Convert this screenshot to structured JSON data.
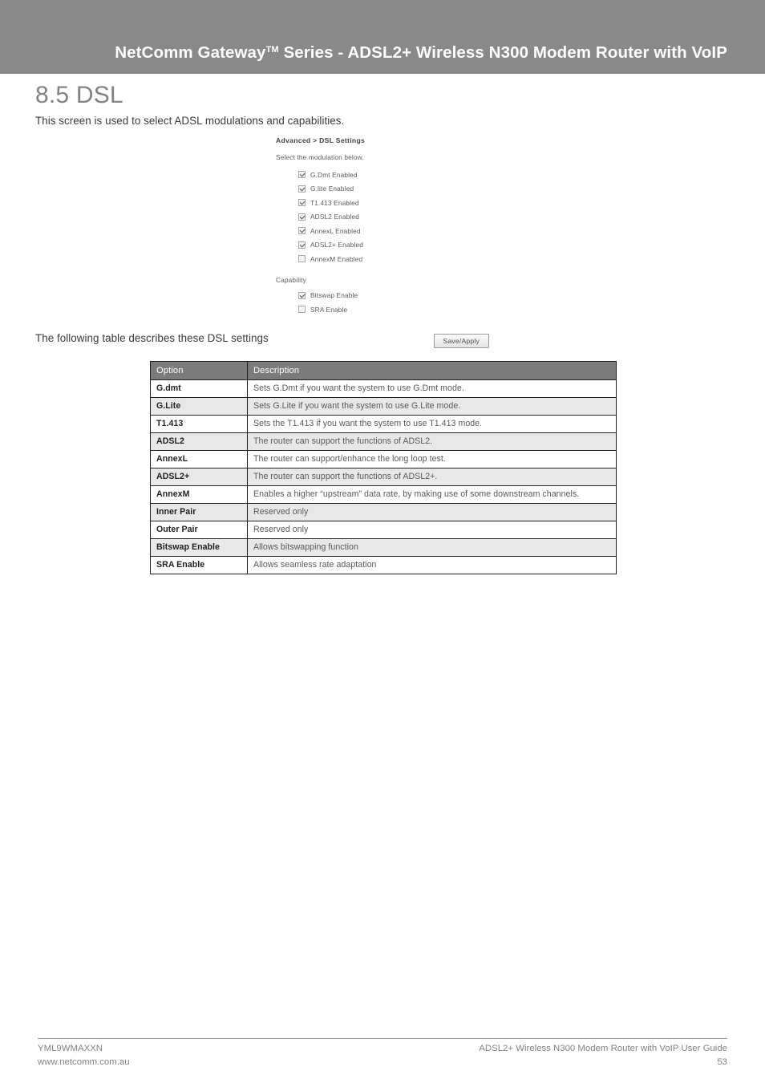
{
  "header": {
    "title_before_tm": "NetComm Gateway",
    "tm": "TM",
    "title_after_tm": " Series - ADSL2+ Wireless N300 Modem Router with VoIP",
    "band_color": "#898989"
  },
  "section": {
    "heading": "8.5 DSL",
    "intro": "This screen is used to select ADSL modulations and capabilities.",
    "table_lead": "The following table describes these DSL settings"
  },
  "router_ui": {
    "breadcrumb": "Advanced > DSL Settings",
    "modulation_prompt": "Select the modulation below.",
    "modulation_options": [
      {
        "label": "G.Dmt Enabled",
        "checked": true
      },
      {
        "label": "G.lite Enabled",
        "checked": true
      },
      {
        "label": "T1.413 Enabled",
        "checked": true
      },
      {
        "label": "ADSL2 Enabled",
        "checked": true
      },
      {
        "label": "AnnexL Enabled",
        "checked": true
      },
      {
        "label": "ADSL2+ Enabled",
        "checked": true
      },
      {
        "label": "AnnexM Enabled",
        "checked": false
      }
    ],
    "capability_label": "Capability",
    "capability_options": [
      {
        "label": "Bitswap Enable",
        "checked": true
      },
      {
        "label": "SRA Enable",
        "checked": false
      }
    ],
    "save_button": "Save/Apply"
  },
  "table": {
    "headers": [
      "Option",
      "Description"
    ],
    "rows": [
      {
        "option": "G.dmt",
        "description": "Sets G.Dmt if you want the system to use G.Dmt mode."
      },
      {
        "option": "G.Lite",
        "description": "Sets G.Lite if you want the system to use G.Lite mode."
      },
      {
        "option": "T1.413",
        "description": "Sets the T1.413 if you want the system to use T1.413 mode."
      },
      {
        "option": "ADSL2",
        "description": "The router can support the functions of ADSL2."
      },
      {
        "option": "AnnexL",
        "description": "The router can support/enhance the long loop test."
      },
      {
        "option": "ADSL2+",
        "description": "The router can support the functions of ADSL2+."
      },
      {
        "option": "AnnexM",
        "description": "Enables a higher “upstream” data rate, by making use of some downstream channels."
      },
      {
        "option": "Inner Pair",
        "description": "Reserved only"
      },
      {
        "option": "Outer Pair",
        "description": "Reserved only"
      },
      {
        "option": "Bitswap Enable",
        "description": "Allows bitswapping function"
      },
      {
        "option": "SRA Enable",
        "description": "Allows seamless rate adaptation"
      }
    ]
  },
  "footer": {
    "doc_code": "YML9WMAXXN",
    "website": "www.netcomm.com.au",
    "guide_name": "ADSL2+ Wireless N300 Modem Router with VoIP User Guide",
    "page_number": "53"
  }
}
